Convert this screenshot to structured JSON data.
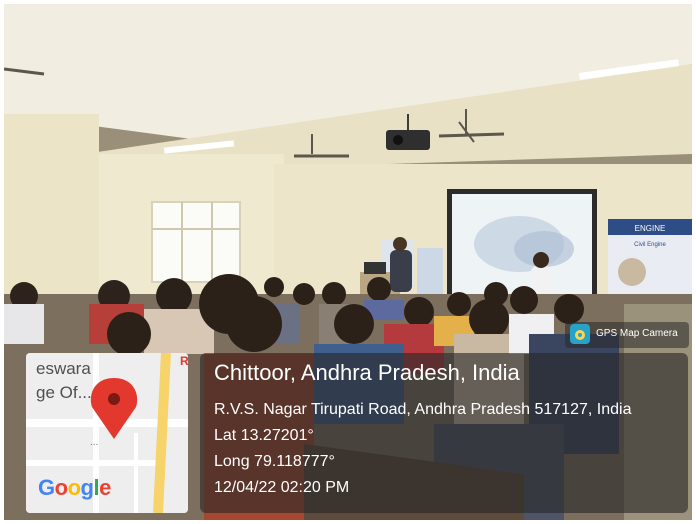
{
  "photo": {
    "description_none": "",
    "colors": {
      "wall": "#efe9cf",
      "ceiling": "#f3efe2",
      "screen": "#eef3f6",
      "overlay": "#2a2a2a"
    }
  },
  "gps_overlay": {
    "city": "Chittoor, Andhra Pradesh, India",
    "address": "R.V.S. Nagar Tirupati Road, Andhra Pradesh 517127, India",
    "latitude": "Lat 13.27201°",
    "longitude": "Long 79.118777°",
    "timestamp": "12/04/22 02:20 PM"
  },
  "map_thumbnail": {
    "label_line1": "eswara",
    "label_line2": "ge Of...",
    "dots": "...",
    "logo_letters": [
      "G",
      "o",
      "o",
      "g",
      "l",
      "e"
    ],
    "logo_colors": [
      "#4285F4",
      "#EA4335",
      "#FBBC05",
      "#4285F4",
      "#34A853",
      "#EA4335"
    ],
    "pin_color": "#e2382d"
  },
  "brand": {
    "name": "GPS Map Camera",
    "icon": "gps-map-camera-icon"
  },
  "wall_banner": {
    "line1": "ENGINE",
    "line2": "Civil Engine"
  },
  "screen_edge_label": "R"
}
